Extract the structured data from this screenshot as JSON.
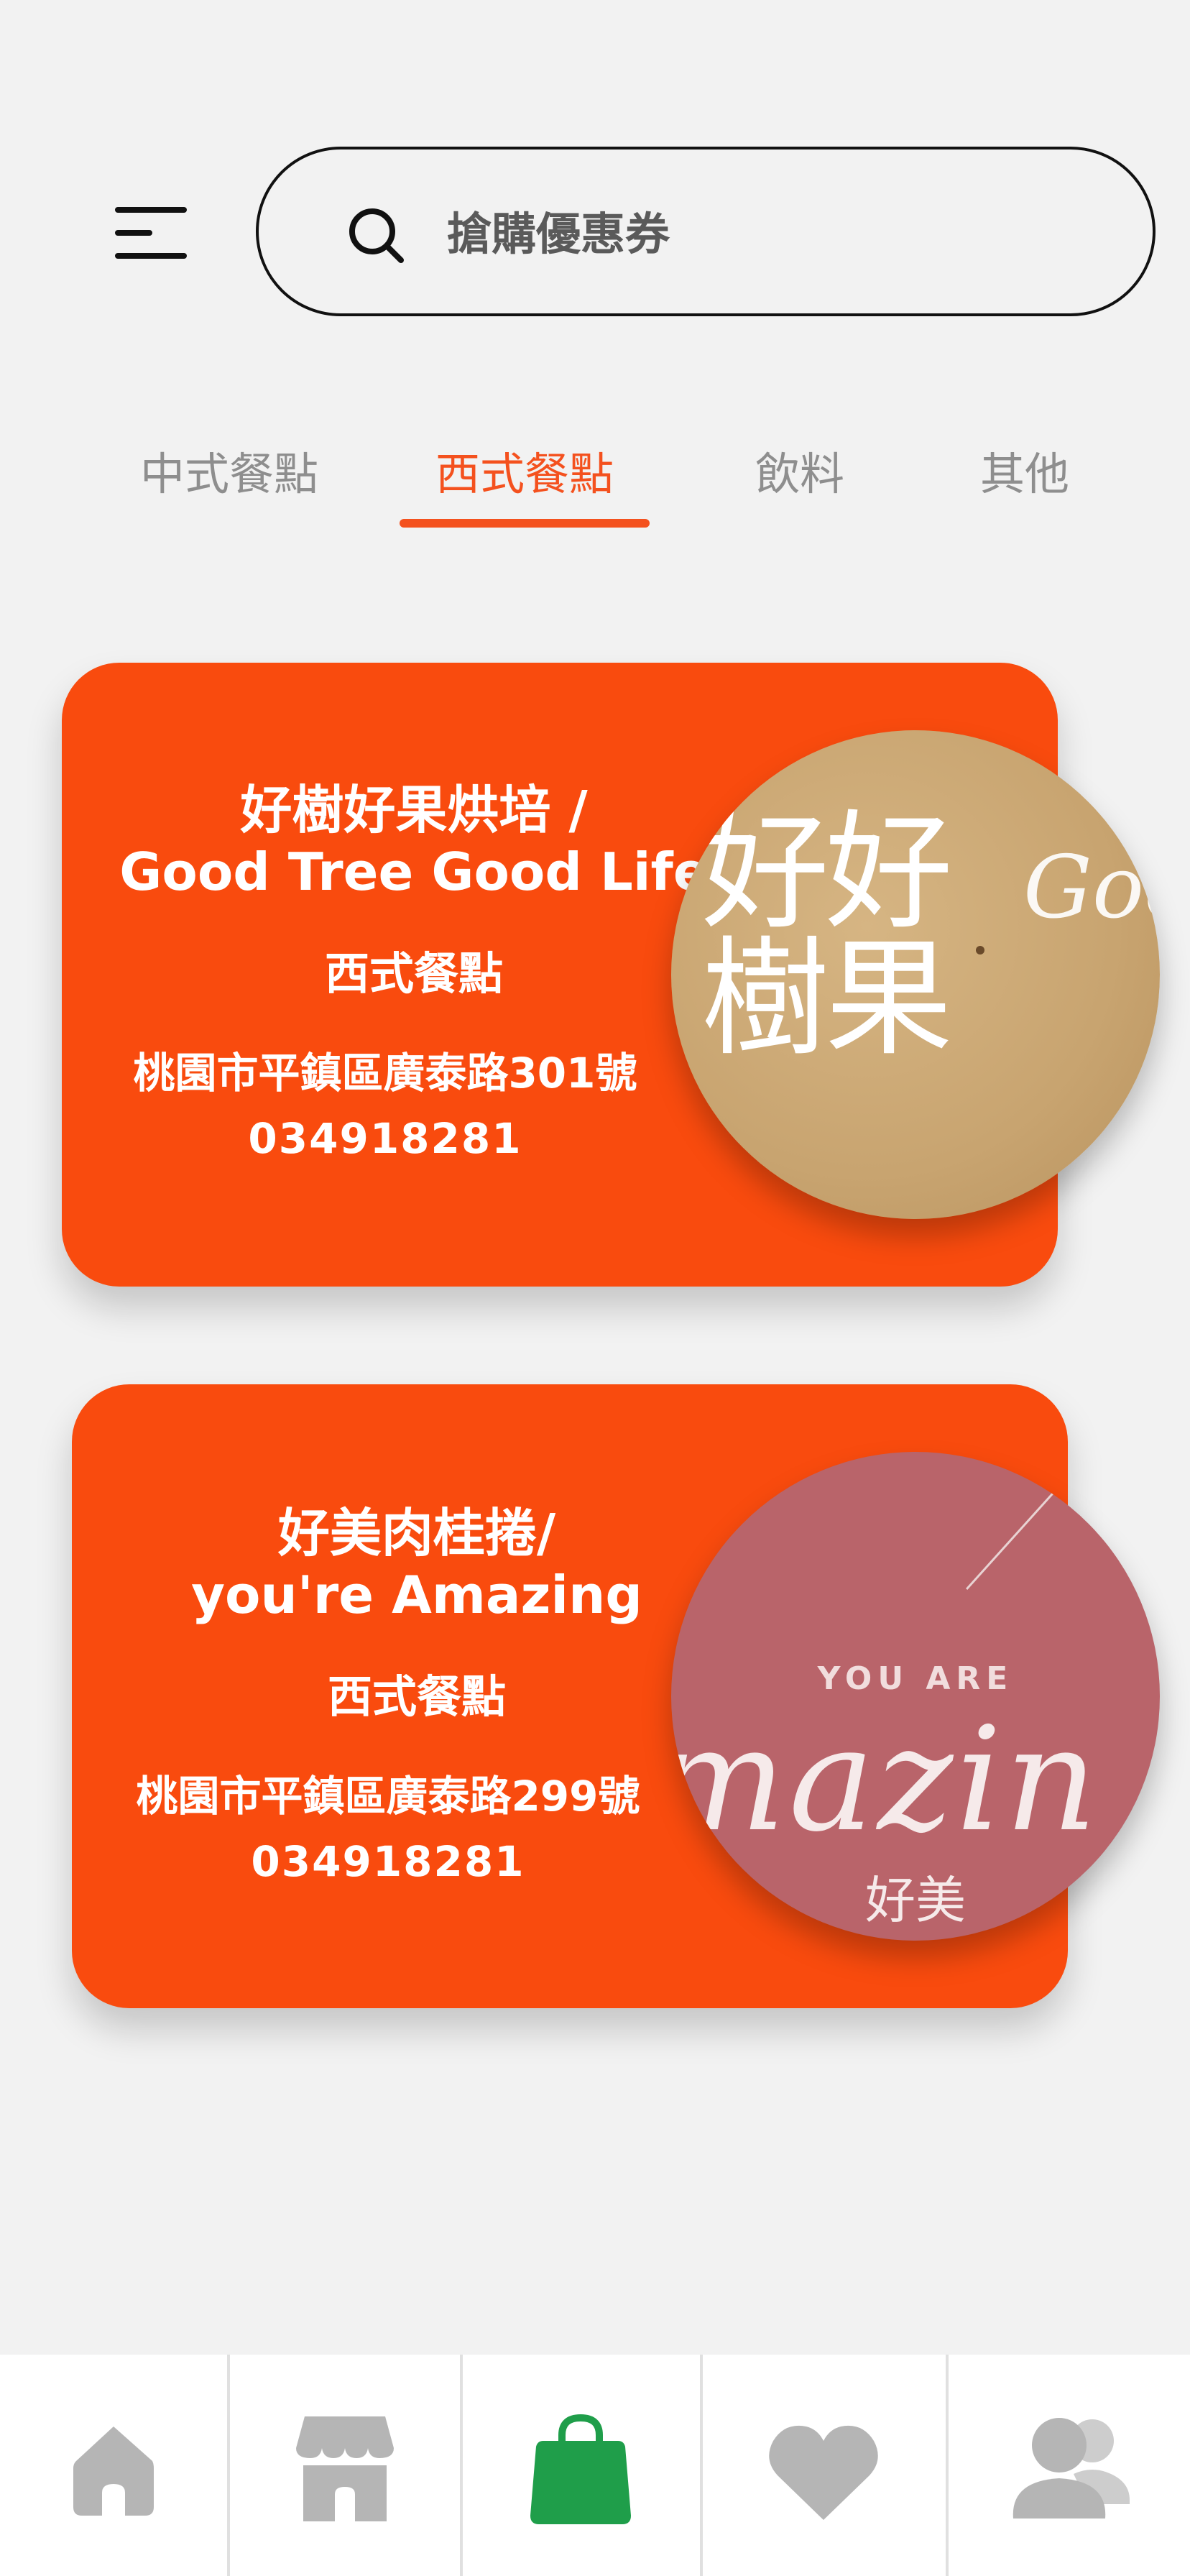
{
  "search": {
    "placeholder": "搶購優惠券",
    "value": ""
  },
  "tabs": [
    {
      "label": "中式餐點",
      "active": false
    },
    {
      "label": "西式餐點",
      "active": true
    },
    {
      "label": "飲料",
      "active": false
    },
    {
      "label": "其他",
      "active": false
    }
  ],
  "stores": [
    {
      "name_zh": "好樹好果烘培 /",
      "name_en": "Good Tree Good Life",
      "category": "西式餐點",
      "address": "桃園市平鎮區廣泰路301號",
      "phone": "034918281",
      "logo_text": [
        "好好",
        "樹果"
      ],
      "logo_script": "Goo"
    },
    {
      "name_zh": "好美肉桂捲/",
      "name_en": "you're Amazing",
      "category": "西式餐點",
      "address": "桃園市平鎮區廣泰路299號",
      "phone": "034918281",
      "logo_top": "YOU ARE",
      "logo_script": "mazin",
      "logo_bottom": "好美"
    }
  ],
  "nav": [
    {
      "icon": "home-icon",
      "active": false
    },
    {
      "icon": "store-icon",
      "active": false
    },
    {
      "icon": "shopping-bag-icon",
      "active": true
    },
    {
      "icon": "heart-icon",
      "active": false
    },
    {
      "icon": "users-icon",
      "active": false
    }
  ],
  "colors": {
    "accent": "#f94b0e",
    "active_nav": "#1f9e4a",
    "inactive_nav": "#b5b5b5"
  }
}
